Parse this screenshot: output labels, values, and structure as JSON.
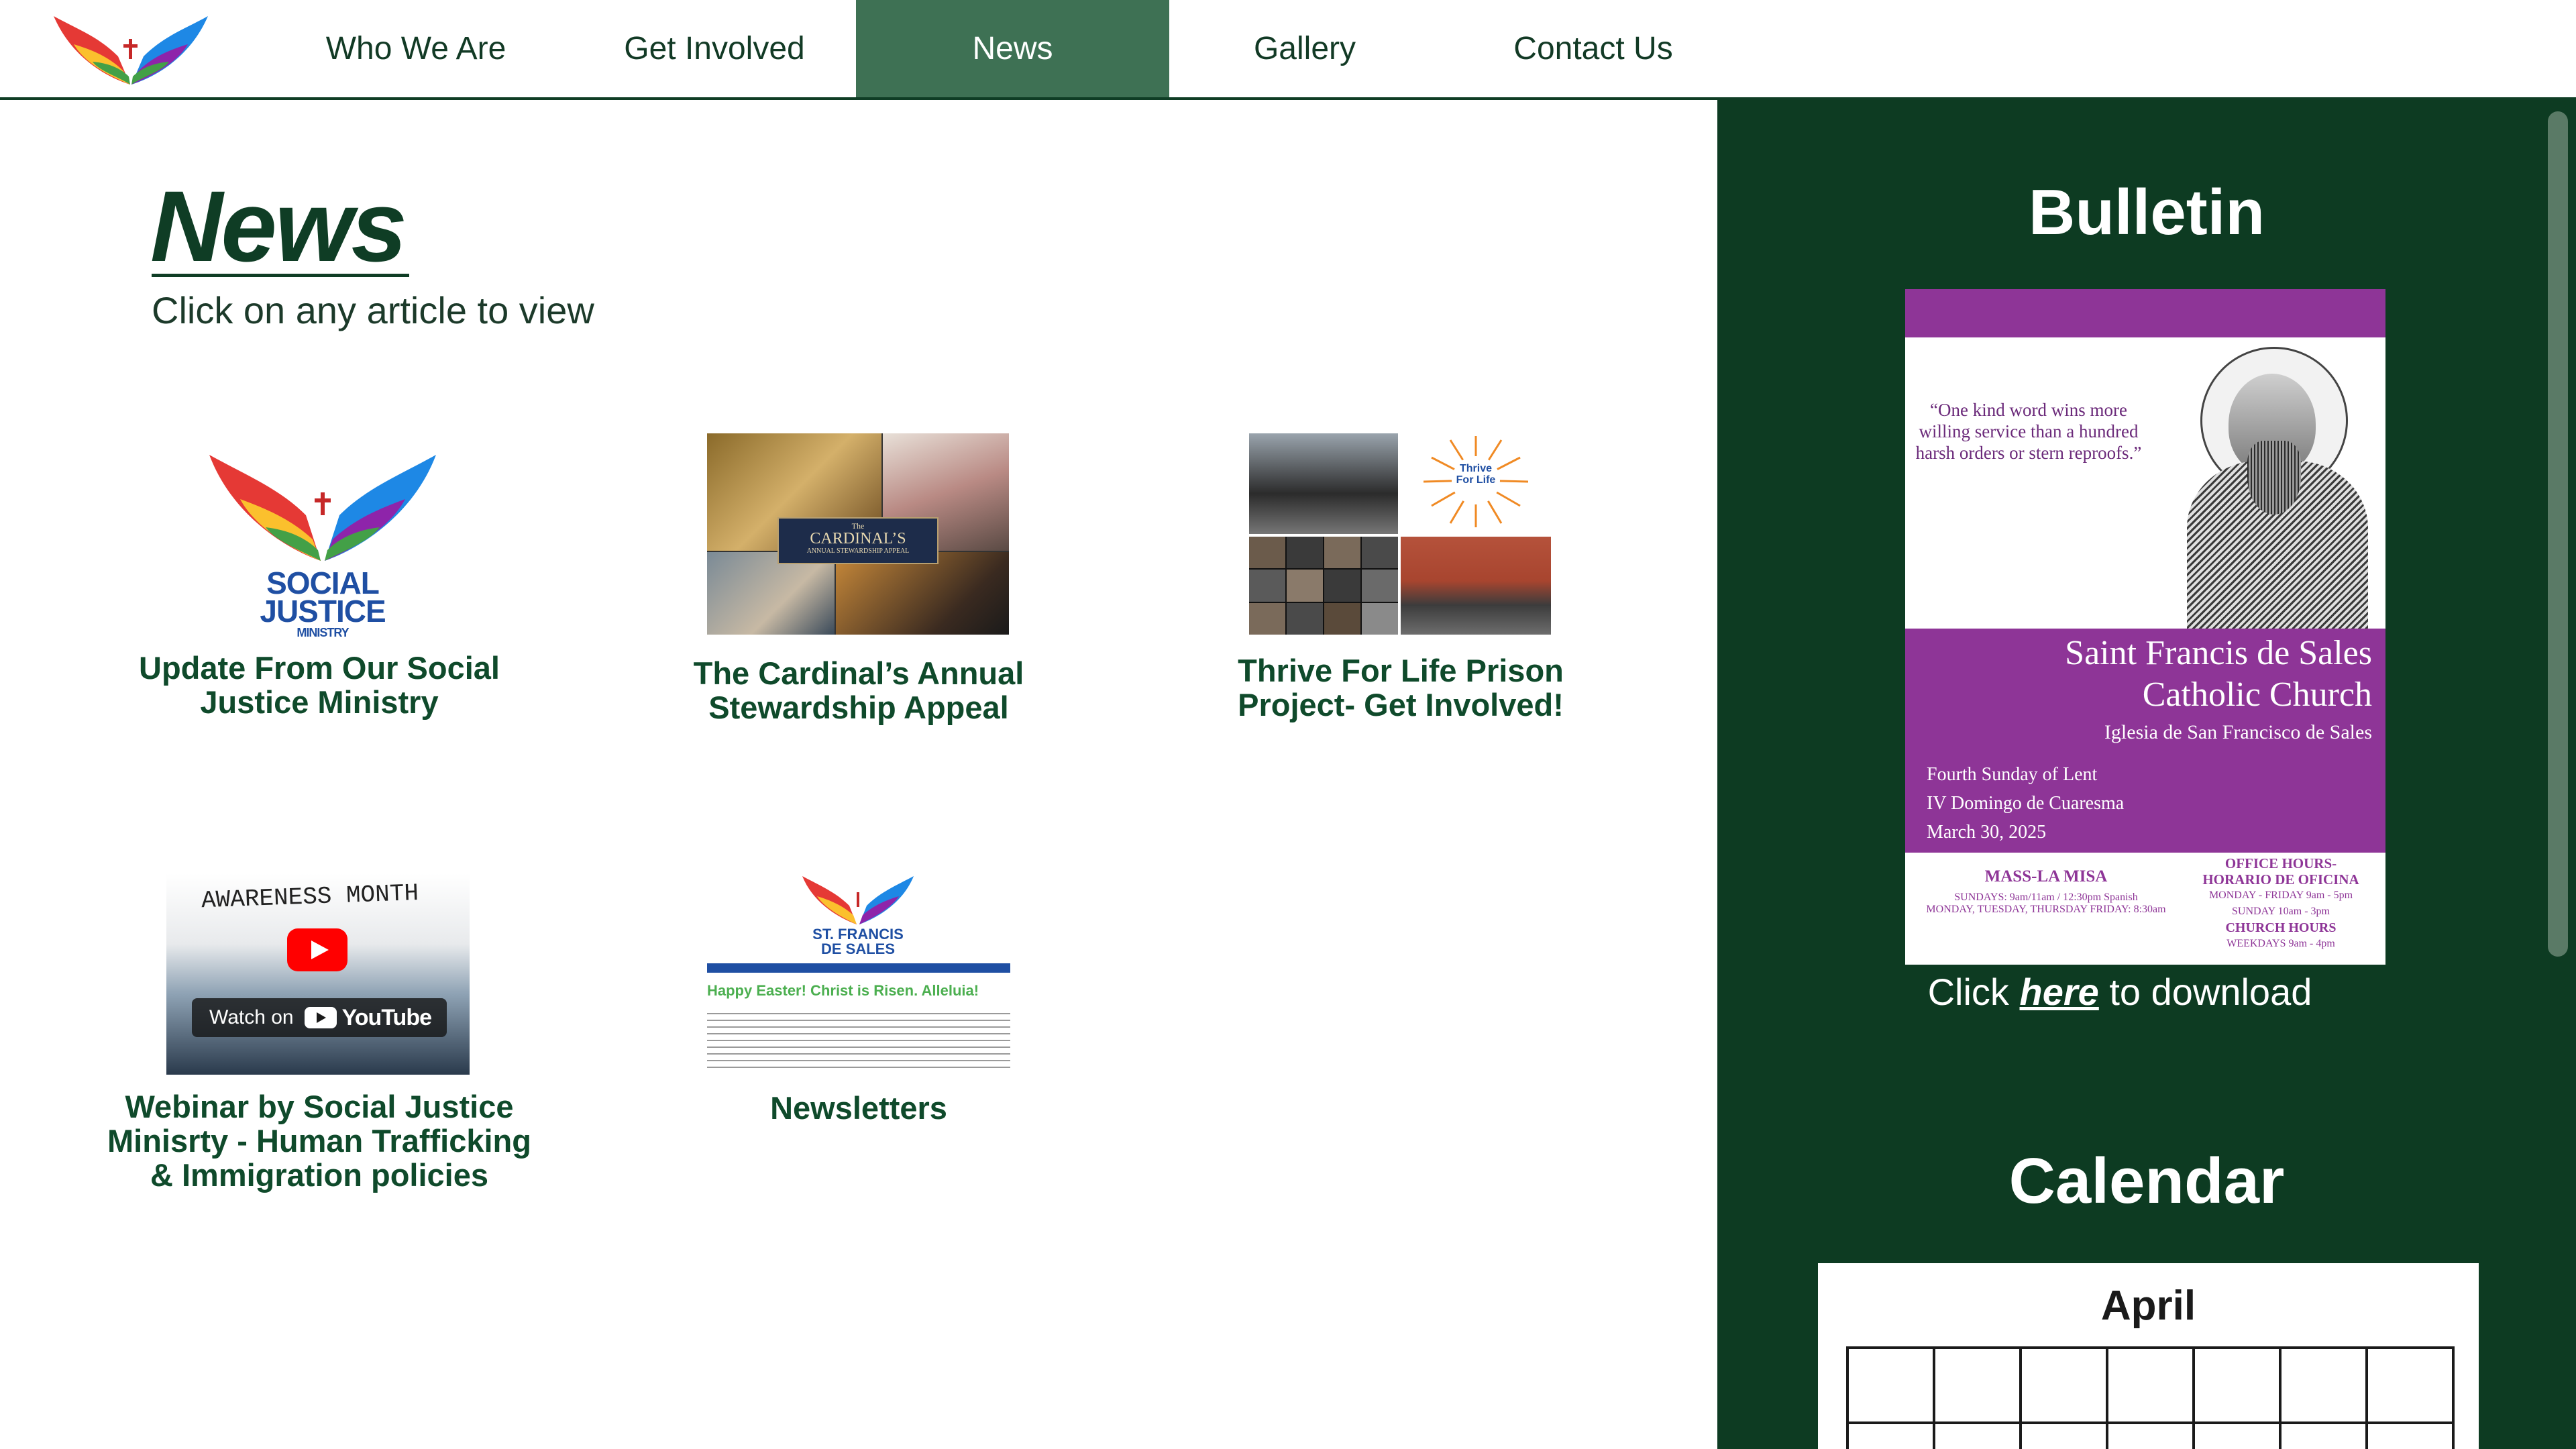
{
  "header": {
    "nav": [
      {
        "label": "Who We Are"
      },
      {
        "label": "Get Involved"
      },
      {
        "label": "News"
      },
      {
        "label": "Gallery"
      },
      {
        "label": "Contact Us"
      }
    ],
    "active_nav": "News",
    "logo_icon": "dove-wings-logo"
  },
  "main": {
    "title": "News",
    "subtitle": "Click on any article to view",
    "articles": [
      {
        "title": "Update From Our Social Justice Ministry",
        "thumb_text": [
          "SOCIAL",
          "JUSTICE",
          "MINISTRY"
        ]
      },
      {
        "title": "The Cardinal’s Annual Stewardship Appeal",
        "thumb_text": [
          "The",
          "CARDINAL’S",
          "ANNUAL STEWARDSHIP APPEAL"
        ]
      },
      {
        "title": "Thrive For Life Prison Project- Get Involved!",
        "thumb_text": [
          "Thrive",
          "For Life"
        ]
      },
      {
        "title": "Webinar by Social Justice Minisrty - Human Trafficking & Immigration policies",
        "thumb_text": [
          "AWARENESS MONTH",
          "Watch on",
          "YouTube"
        ]
      },
      {
        "title": "Newsletters",
        "thumb_text": [
          "ST. FRANCIS",
          "DE SALES",
          "Happy Easter! Christ is Risen. Alleluia!"
        ]
      }
    ]
  },
  "sidebar": {
    "bulletin_heading": "Bulletin",
    "bulletin": {
      "quote": "“One kind word wins more willing service than a hundred harsh orders or stern reproofs.”",
      "church_name_1": "Saint Francis de Sales",
      "church_name_2": "Catholic Church",
      "church_name_es": "Iglesia de San Francisco de Sales",
      "occasion_1": "Fourth Sunday of Lent",
      "occasion_2": "IV Domingo de Cuaresma",
      "date": "March 30, 2025",
      "mass_heading": "MASS-LA MISA",
      "mass_line_1": "SUNDAYS:  9am/11am / 12:30pm Spanish",
      "mass_line_2": "MONDAY, TUESDAY, THURSDAY FRIDAY: 8:30am",
      "office_heading_1": "OFFICE HOURS-",
      "office_heading_2": "HORARIO DE OFICINA",
      "office_line_1": "MONDAY - FRIDAY  9am - 5pm",
      "office_line_2": "SUNDAY  10am - 3pm",
      "church_hours_heading": "CHURCH HOURS",
      "church_hours_line": "WEEKDAYS  9am - 4pm"
    },
    "download_prefix": "Click ",
    "download_link": "here",
    "download_suffix": " to download",
    "calendar_heading": "Calendar",
    "calendar_month": "April"
  },
  "colors": {
    "brand_green": "#0f3d25",
    "nav_active": "#3e7154",
    "bulletin_purple": "#8e3597"
  }
}
